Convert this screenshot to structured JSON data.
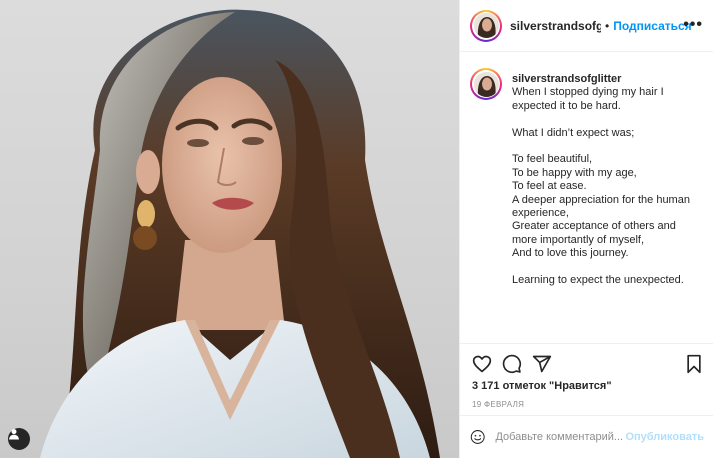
{
  "post": {
    "username": "silverstrandsofglitter",
    "header_username_display": "silverstrandsofglitte",
    "separator": "•",
    "follow_label": "Подписаться",
    "more_label": "•••",
    "caption_lines": [
      "When I stopped dying my hair I",
      "expected it to be hard.",
      "",
      "What I didn’t expect was;",
      "",
      "To feel beautiful,",
      "To be happy with my age,",
      "To feel at ease.",
      "A deeper appreciation for the human",
      "experience,",
      "Greater acceptance of others and",
      "more importantly of myself,",
      "And to love this journey.",
      "",
      "Learning to expect the unexpected."
    ],
    "likes_text": "3 171 отметок \"Нравится\"",
    "date_text": "19 ФЕВРАЛЯ",
    "comment_placeholder": "Добавьте комментарий...",
    "publish_label": "Опубликовать"
  },
  "icons": [
    "heart-icon",
    "comment-icon",
    "share-icon",
    "bookmark-icon",
    "emoji-icon",
    "user-tag-icon",
    "more-icon"
  ],
  "colors": {
    "accent": "#0095f6",
    "publish_disabled": "#b2dffc",
    "muted": "#8e8e8e",
    "border": "#efefef",
    "text": "#262626"
  }
}
